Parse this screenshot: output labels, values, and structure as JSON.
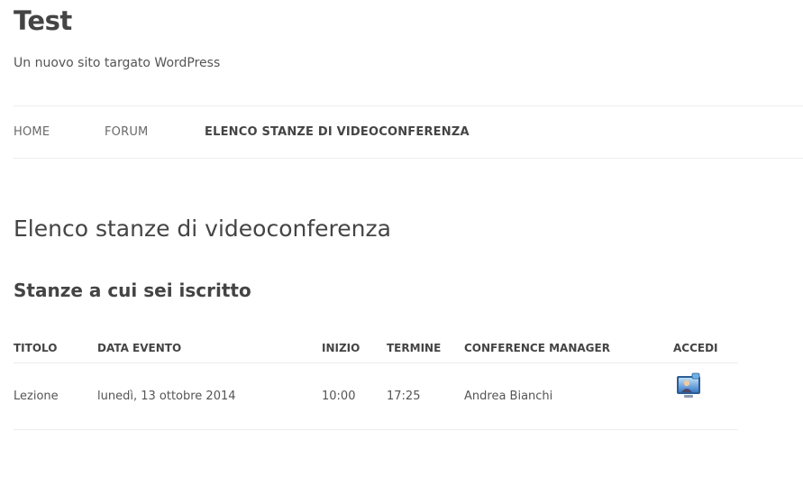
{
  "site": {
    "title": "Test",
    "description": "Un nuovo sito targato WordPress"
  },
  "nav": {
    "items": [
      {
        "label": "HOME"
      },
      {
        "label": "FORUM"
      },
      {
        "label": "ELENCO STANZE DI VIDEOCONFERENZA",
        "current": true
      }
    ]
  },
  "page": {
    "title": "Elenco stanze di videoconferenza",
    "section_title": "Stanze a cui sei iscritto"
  },
  "table": {
    "headers": [
      "TITOLO",
      "DATA EVENTO",
      "INIZIO",
      "TERMINE",
      "CONFERENCE MANAGER",
      "ACCEDI"
    ],
    "rows": [
      {
        "titolo": "Lezione",
        "data_evento": "lunedì, 13 ottobre 2014",
        "inizio": "10:00",
        "termine": "17:25",
        "manager": "Andrea Bianchi",
        "accedi_icon": "videoconference-icon"
      }
    ]
  },
  "colors": {
    "text": "#444444",
    "divider": "#ededed",
    "icon_blue": "#3a7bc8"
  }
}
